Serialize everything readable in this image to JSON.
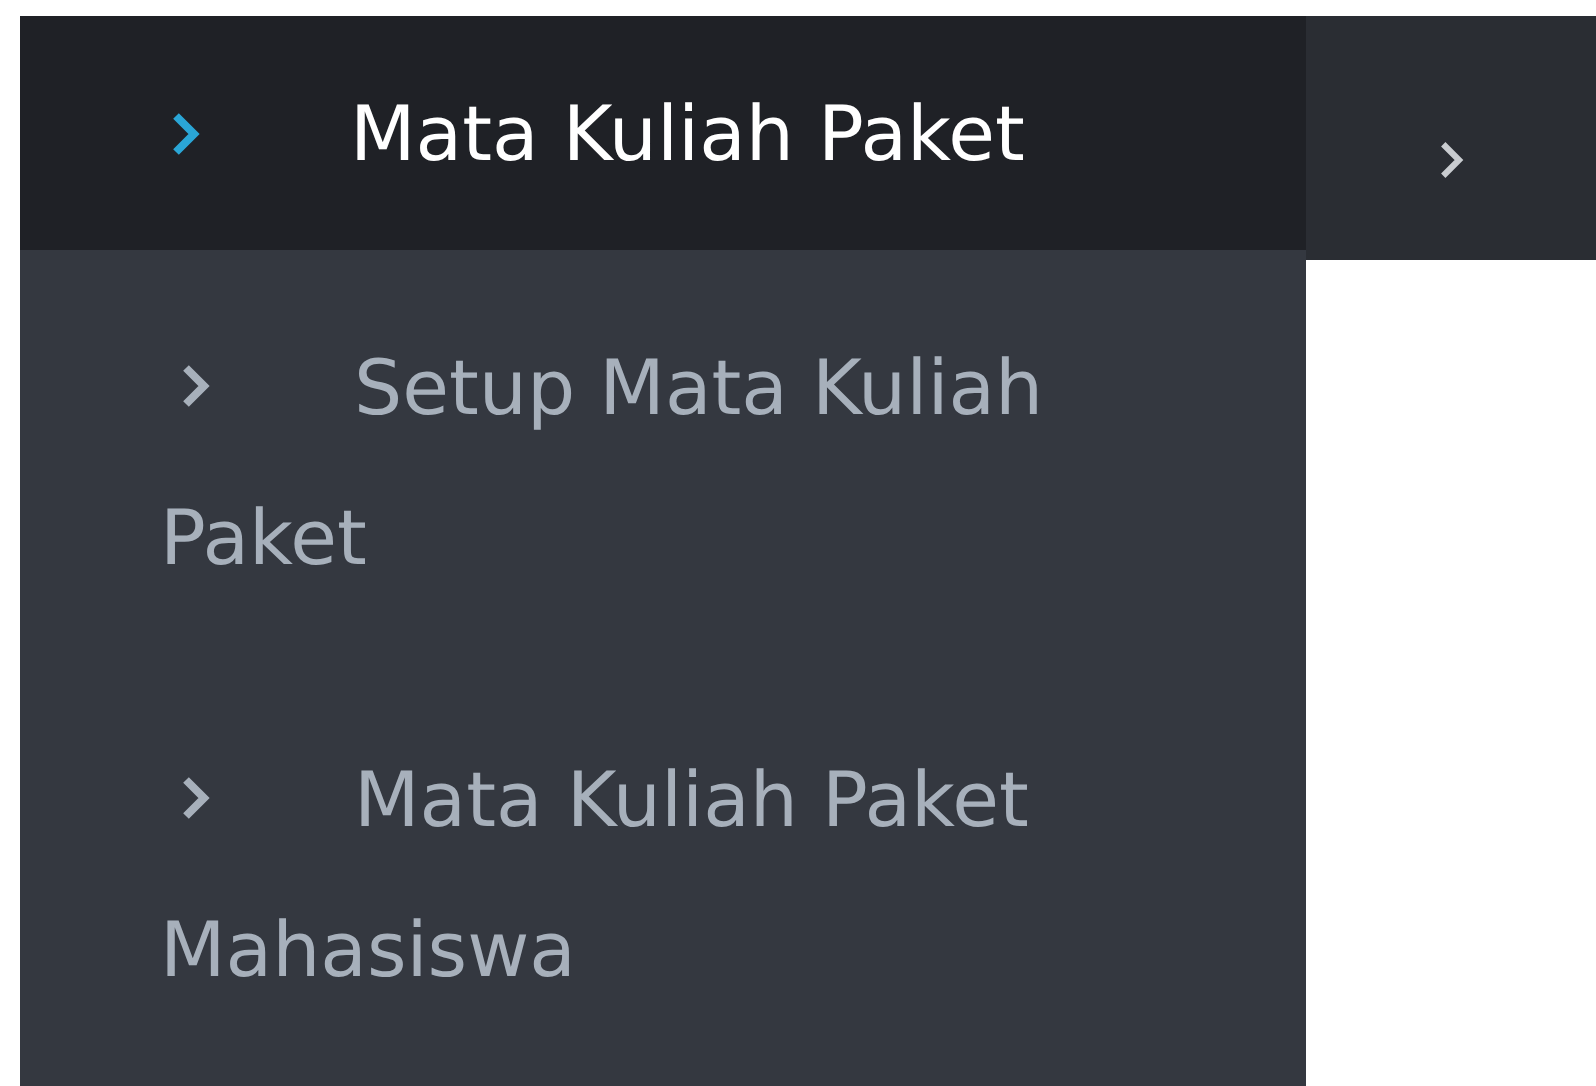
{
  "menu": {
    "header": {
      "label": "Mata Kuliah Paket"
    },
    "items": [
      {
        "label": "Setup Mata Kuliah Paket"
      },
      {
        "label": "Mata Kuliah Paket Mahasiswa"
      }
    ]
  }
}
